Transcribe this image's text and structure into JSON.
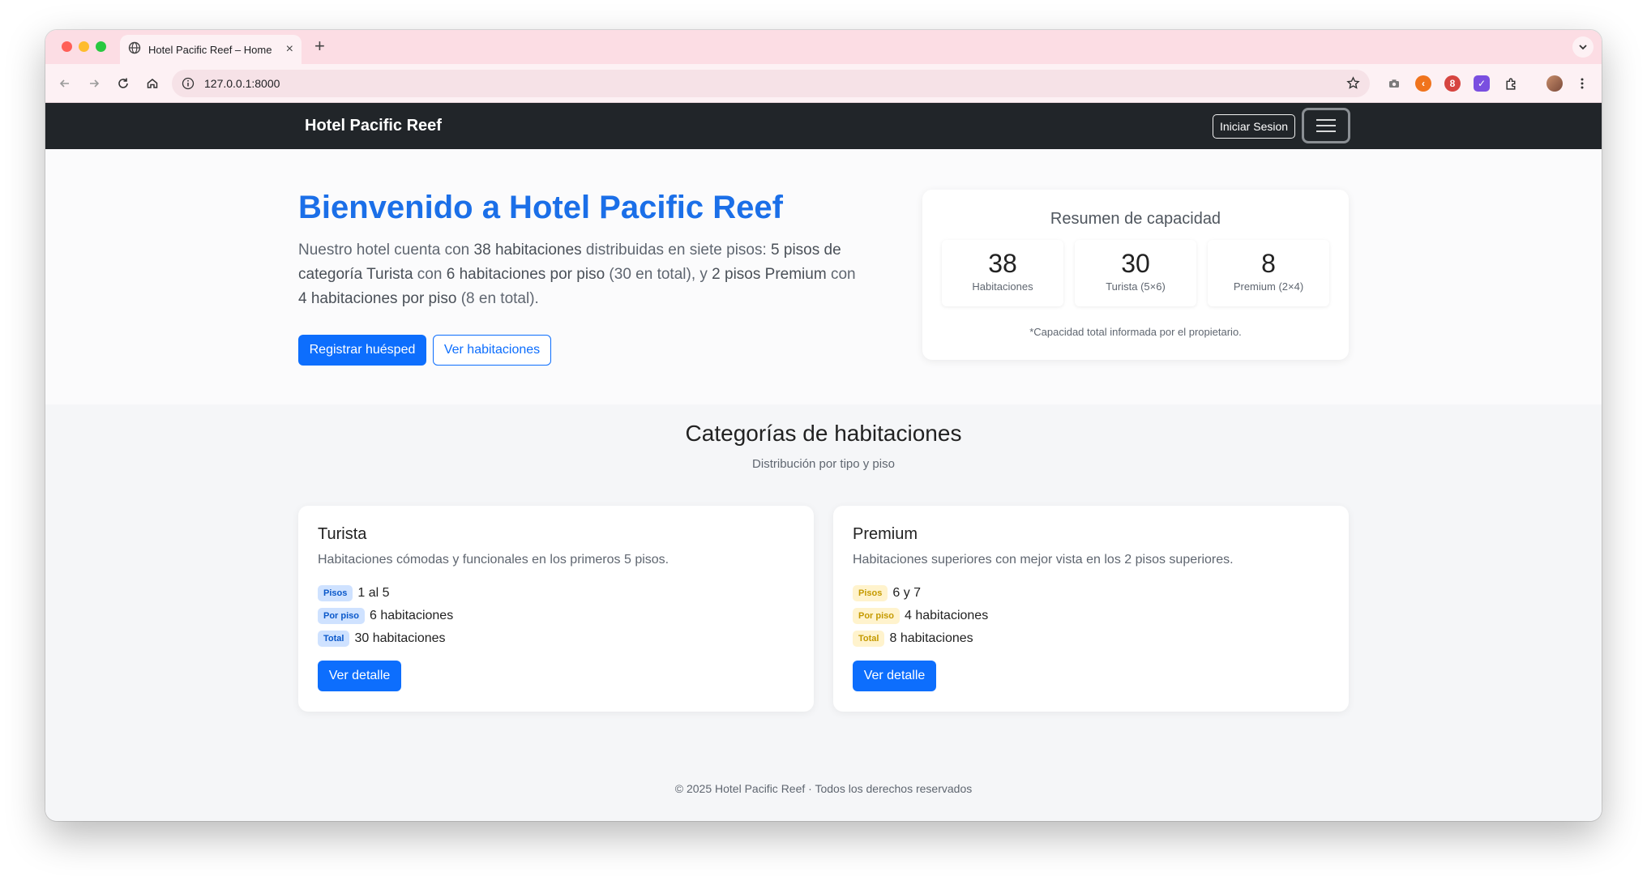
{
  "browser": {
    "tab_title": "Hotel Pacific Reef – Home",
    "new_tab": "+",
    "url": "127.0.0.1:8000"
  },
  "nav": {
    "brand": "Hotel Pacific Reef",
    "login": "Iniciar Sesion"
  },
  "hero": {
    "title": "Bienvenido a Hotel Pacific Reef",
    "lead": {
      "p1": "Nuestro hotel cuenta con ",
      "b1": "38 habitaciones",
      "p2": " distribuidas en siete pisos: ",
      "b2": "5 pisos de categoría Turista",
      "p3": " con ",
      "b3": "6 habitaciones por piso",
      "p4": " (30 en total), y ",
      "b4": "2 pisos Premium",
      "p5": " con ",
      "b5": "4 habitaciones por piso",
      "p6": " (8 en total)."
    },
    "btn_register": "Registrar huésped",
    "btn_rooms": "Ver habitaciones"
  },
  "capacity": {
    "title": "Resumen de capacidad",
    "stats": [
      {
        "value": "38",
        "label": "Habitaciones"
      },
      {
        "value": "30",
        "label": "Turista (5×6)"
      },
      {
        "value": "8",
        "label": "Premium (2×4)"
      }
    ],
    "note": "*Capacidad total informada por el propietario."
  },
  "categories": {
    "title": "Categorías de habitaciones",
    "subtitle": "Distribución por tipo y piso",
    "cards": [
      {
        "title": "Turista",
        "desc": "Habitaciones cómodas y funcionales en los primeros 5 pisos.",
        "rows": [
          {
            "badge": "Pisos",
            "value": "1 al 5"
          },
          {
            "badge": "Por piso",
            "value": "6 habitaciones"
          },
          {
            "badge": "Total",
            "value": "30 habitaciones"
          }
        ],
        "button": "Ver detalle",
        "badge_color": "#cfe2ff"
      },
      {
        "title": "Premium",
        "desc": "Habitaciones superiores con mejor vista en los 2 pisos superiores.",
        "rows": [
          {
            "badge": "Pisos",
            "value": "6 y 7"
          },
          {
            "badge": "Por piso",
            "value": "4 habitaciones"
          },
          {
            "badge": "Total",
            "value": "8 habitaciones"
          }
        ],
        "button": "Ver detalle",
        "badge_color": "#fff3cd"
      }
    ]
  },
  "footer": "© 2025 Hotel Pacific Reef · Todos los derechos reservados",
  "colors": {
    "accent": "#0d6efd",
    "title_blue": "#1b6fe8",
    "navbar": "#212529",
    "tab_strip": "#fcdde4"
  }
}
